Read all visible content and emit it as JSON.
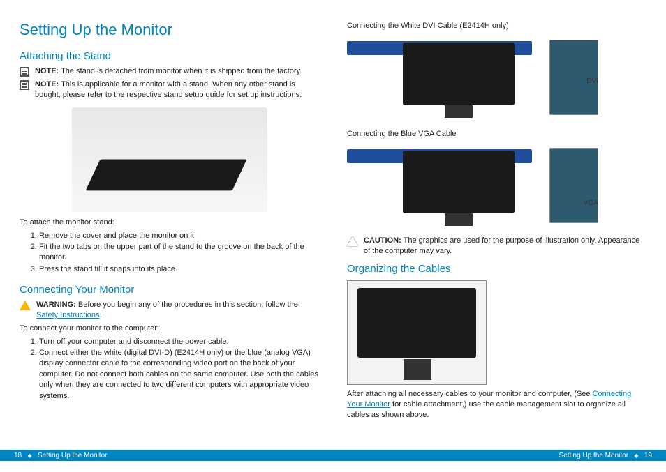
{
  "title": "Setting Up the Monitor",
  "sections": {
    "attaching": {
      "heading": "Attaching the Stand",
      "note1_label": "NOTE:",
      "note1_text": " The stand is detached from monitor when it is shipped from the factory.",
      "note2_label": "NOTE:",
      "note2_text": " This is applicable for a monitor with a stand. When any other stand is bought, please refer to the respective stand setup guide for set up instructions.",
      "lead": "To attach the monitor stand:",
      "steps": [
        "Remove the cover and place the monitor on it.",
        "Fit the two tabs on the upper part of the stand to the groove on the back of the monitor.",
        "Press the stand till it snaps into its place."
      ]
    },
    "connecting": {
      "heading": "Connecting Your Monitor",
      "warn_label": "WARNING:",
      "warn_text_before": " Before you begin any of the procedures in this section, follow the ",
      "warn_link": "Safety Instructions",
      "warn_text_after": ".",
      "lead": "To connect your monitor to the computer:",
      "steps": [
        "Turn off your computer and disconnect the power cable.",
        "Connect either the white (digital DVI-D) (E2414H only) or the blue (analog VGA) display connector cable to the corresponding video port on the back of your computer. Do not connect both cables on the same computer. Use both the cables only when they are connected to two different computers with appropriate video systems."
      ]
    },
    "right": {
      "dvi_caption": "Connecting the White DVI Cable (E2414H only)",
      "dvi_label": "DVI",
      "vga_caption": "Connecting the Blue VGA Cable",
      "vga_label": "VGA",
      "caution_label": "CAUTION:",
      "caution_text": " The graphics are used for the purpose of illustration only. Appearance of the computer may vary.",
      "organizing_heading": "Organizing the Cables",
      "organizing_text_before": "After attaching all necessary cables to your monitor and computer, (See ",
      "organizing_link": "Connecting Your Monitor",
      "organizing_text_after": " for cable attachment,) use the cable management slot to organize all cables as shown above."
    }
  },
  "footer": {
    "left_page": "18",
    "left_title": "Setting Up the Monitor",
    "right_title": "Setting Up the Monitor",
    "right_page": "19"
  }
}
